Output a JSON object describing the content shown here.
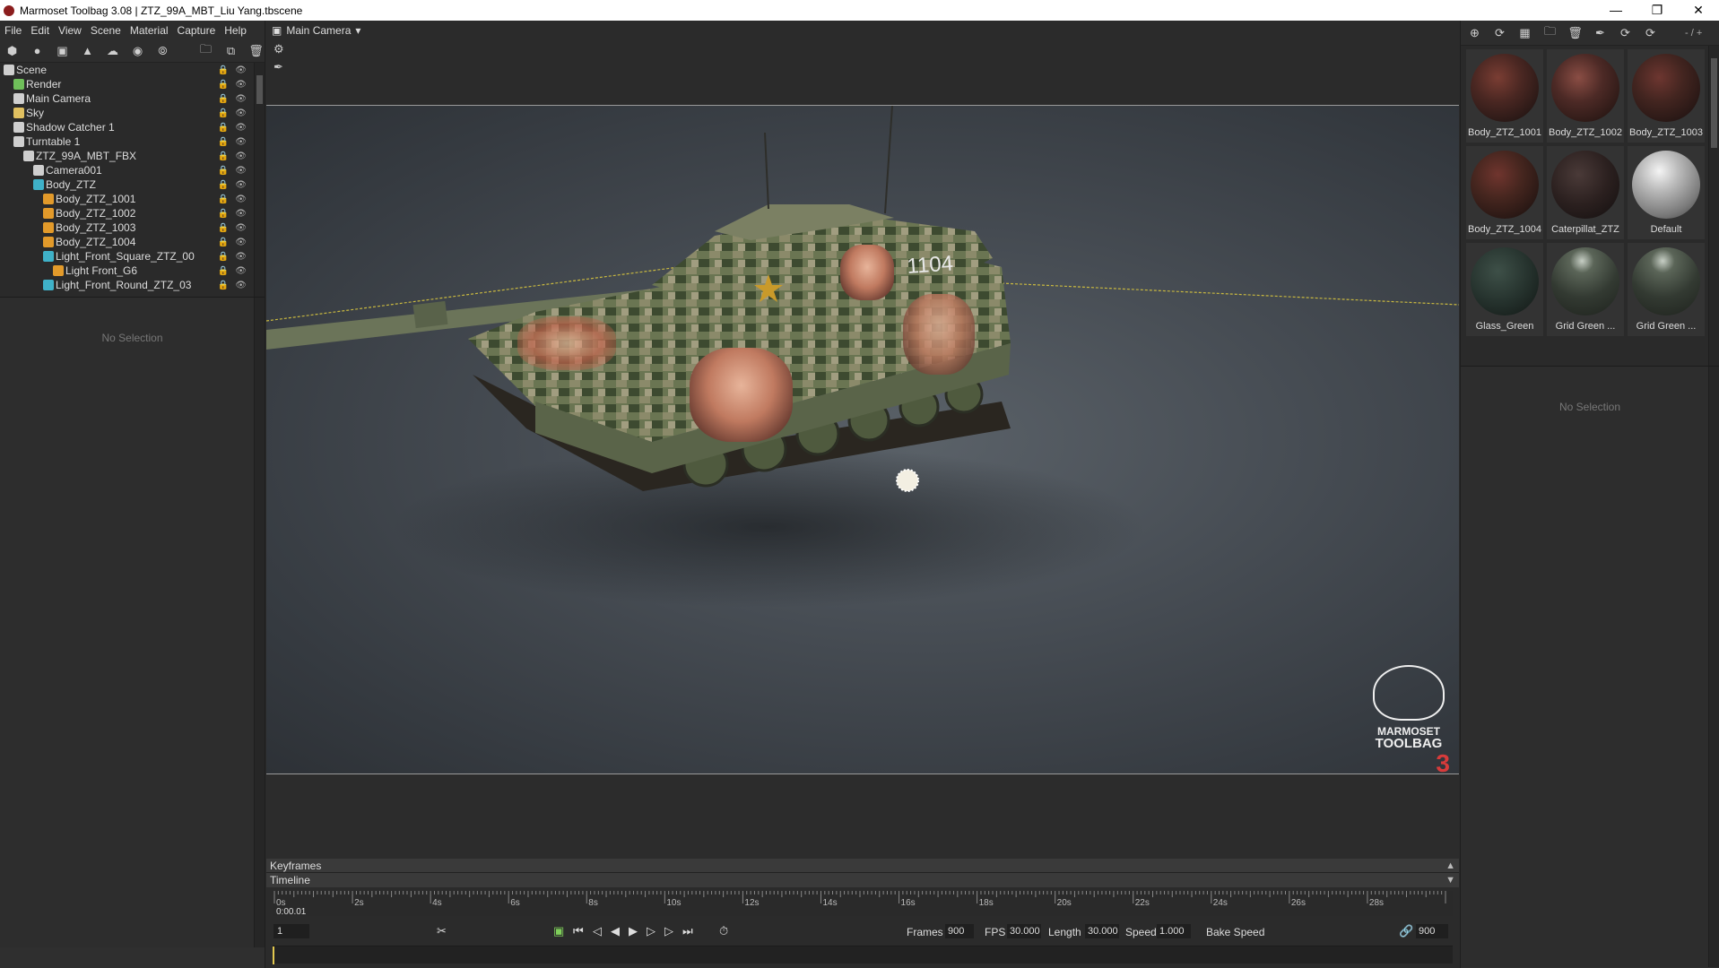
{
  "window": {
    "title": "Marmoset Toolbag 3.08  |  ZTZ_99A_MBT_Liu Yang.tbscene",
    "minimize_icon": "minimize-icon",
    "maximize_icon": "restore-icon",
    "close_icon": "close-icon"
  },
  "menu": [
    "File",
    "Edit",
    "View",
    "Scene",
    "Material",
    "Capture",
    "Help"
  ],
  "scene_tree": {
    "rows": [
      {
        "label": "Scene",
        "indent": 0,
        "icon": "scene-icon",
        "color": "#cfcfcf"
      },
      {
        "label": "Render",
        "indent": 1,
        "icon": "render-icon",
        "color": "#6fbf5a"
      },
      {
        "label": "Main Camera",
        "indent": 1,
        "icon": "camera-icon",
        "color": "#cfcfcf"
      },
      {
        "label": "Sky",
        "indent": 1,
        "icon": "sky-icon",
        "color": "#e0c060"
      },
      {
        "label": "Shadow Catcher 1",
        "indent": 1,
        "icon": "shadow-catcher-icon",
        "color": "#cfcfcf"
      },
      {
        "label": "Turntable 1",
        "indent": 1,
        "icon": "turntable-icon",
        "color": "#cfcfcf"
      },
      {
        "label": "ZTZ_99A_MBT_FBX",
        "indent": 2,
        "icon": "fbx-icon",
        "color": "#cfcfcf"
      },
      {
        "label": "Camera001",
        "indent": 3,
        "icon": "camera-icon",
        "color": "#cfcfcf"
      },
      {
        "label": "Body_ZTZ",
        "indent": 3,
        "icon": "mesh-icon",
        "color": "#3fb1c8"
      },
      {
        "label": "Body_ZTZ_1001",
        "indent": 4,
        "icon": "mesh-icon",
        "color": "#e29a2a"
      },
      {
        "label": "Body_ZTZ_1002",
        "indent": 4,
        "icon": "mesh-icon",
        "color": "#e29a2a"
      },
      {
        "label": "Body_ZTZ_1003",
        "indent": 4,
        "icon": "mesh-icon",
        "color": "#e29a2a"
      },
      {
        "label": "Body_ZTZ_1004",
        "indent": 4,
        "icon": "mesh-icon",
        "color": "#e29a2a"
      },
      {
        "label": "Light_Front_Square_ZTZ_00",
        "indent": 4,
        "icon": "mesh-icon",
        "color": "#3fb1c8"
      },
      {
        "label": "Light Front_G6",
        "indent": 5,
        "icon": "mesh-icon",
        "color": "#e29a2a"
      },
      {
        "label": "Light_Front_Round_ZTZ_03",
        "indent": 4,
        "icon": "mesh-icon",
        "color": "#3fb1c8"
      }
    ]
  },
  "left_props": {
    "empty_text": "No Selection"
  },
  "viewport": {
    "camera_label": "Main Camera",
    "turret_number": "1104",
    "logo_line1": "MARMOSET",
    "logo_line2": "TOOLBAG",
    "logo_number": "3"
  },
  "timeline": {
    "keyframes_label": "Keyframes",
    "timeline_label": "Timeline",
    "ticks": [
      "0s",
      "2s",
      "4s",
      "6s",
      "8s",
      "10s",
      "12s",
      "14s",
      "16s",
      "18s",
      "20s",
      "22s",
      "24s",
      "26s",
      "28s"
    ],
    "current_time": "0:00.01",
    "current_frame": "1",
    "frames_label": "Frames",
    "frames_value": "900",
    "fps_label": "FPS",
    "fps_value": "30.000",
    "length_label": "Length",
    "length_value": "30.000",
    "speed_label": "Speed",
    "speed_value": "1.000",
    "bake_label": "Bake Speed",
    "end_frame": "900"
  },
  "materials": {
    "counter": "- / +",
    "items": [
      {
        "label": "Body_ZTZ_1001",
        "ball": "radial-gradient(circle at 40% 35%, #7a3d33 0%, #4a2722 40%, #261715 80%, #141010 100%)"
      },
      {
        "label": "Body_ZTZ_1002",
        "ball": "radial-gradient(circle at 40% 35%, #8a4d44 0%, #4d2a26 40%, #2a1815 80%, #141010 100%)"
      },
      {
        "label": "Body_ZTZ_1003",
        "ball": "radial-gradient(circle at 40% 35%, #6d3630 0%, #432520 40%, #251614 80%, #141010 100%)"
      },
      {
        "label": "Body_ZTZ_1004",
        "ball": "radial-gradient(circle at 40% 35%, #70352e 0%, #46261f 40%, #251613 80%, #141010 100%)"
      },
      {
        "label": "Caterpillat_ZTZ",
        "ball": "radial-gradient(circle at 40% 35%, #4a3a38 0%, #2b201f 50%, #171212 90%)"
      },
      {
        "label": "Default",
        "ball": "radial-gradient(circle at 40% 30%, #f4f4f4 0%, #bcbcbc 30%, #7a7a7a 70%, #3a3a3a 100%)"
      },
      {
        "label": "Glass_Green",
        "ball": "radial-gradient(circle at 40% 35%, #3e5048 0%, #26332e 50%, #151c19 90%)"
      },
      {
        "label": "Grid Green ...",
        "ball": "radial-gradient(circle at 45% 20%, #c7cfc5 0%, #5b6558 18%, #333a32 55%, #1e221d 100%)"
      },
      {
        "label": "Grid Green ...",
        "ball": "radial-gradient(circle at 45% 20%, #c7cfc5 0%, #5b6558 18%, #333a32 55%, #1e221d 100%)"
      }
    ]
  },
  "right_props": {
    "empty_text": "No Selection"
  }
}
